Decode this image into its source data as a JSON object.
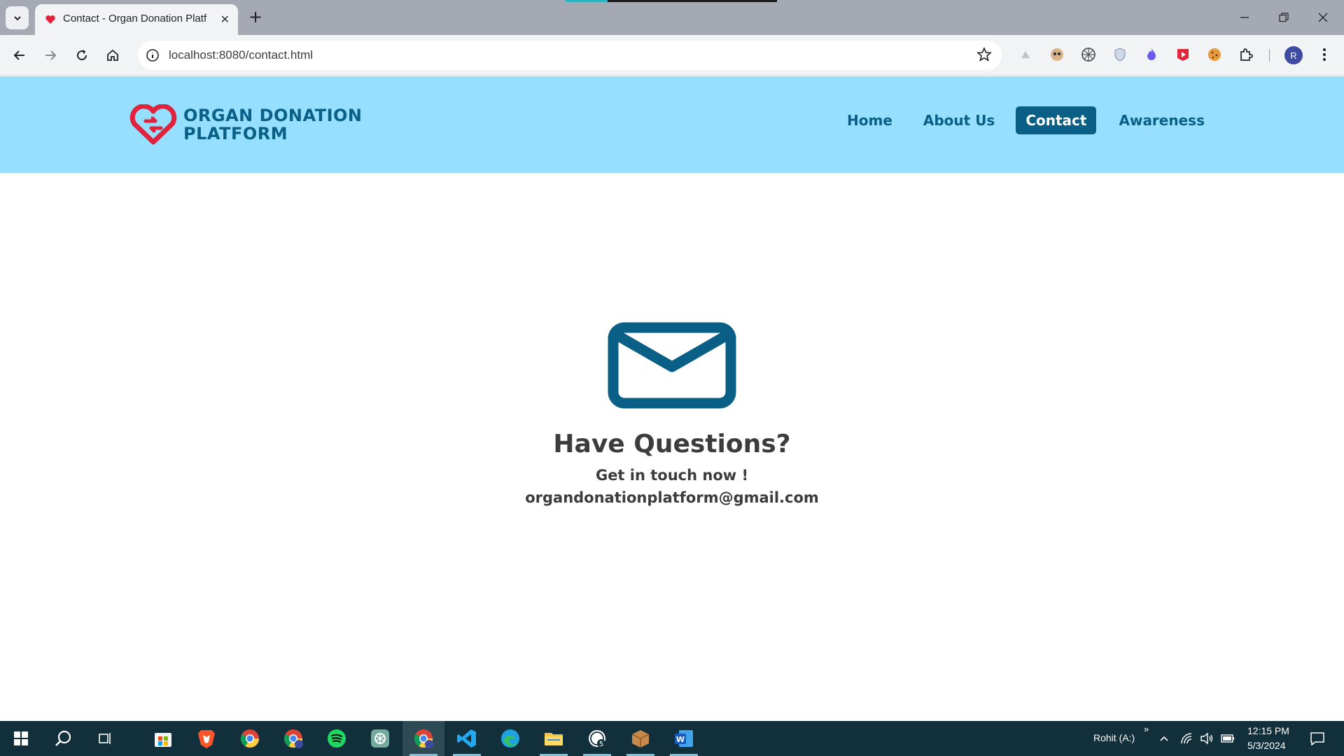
{
  "browser": {
    "tab_title": "Contact - Organ Donation Platf",
    "tab_close": "✕",
    "new_tab": "+",
    "url": "localhost:8080/contact.html",
    "profile_initial": "R"
  },
  "site": {
    "logo_line1": "ORGAN DONATION",
    "logo_line2": "PLATFORM",
    "nav": [
      {
        "label": "Home",
        "active": false
      },
      {
        "label": "About Us",
        "active": false
      },
      {
        "label": "Contact",
        "active": true
      },
      {
        "label": "Awareness",
        "active": false
      }
    ],
    "contact": {
      "title": "Have Questions?",
      "subtitle": "Get in touch now !",
      "email": "organdonationplatform@gmail.com"
    }
  },
  "taskbar": {
    "user": "Rohit (A:)",
    "time": "12:15 PM",
    "date": "5/3/2024",
    "overflow": "»"
  },
  "colors": {
    "header_bg": "#96dffe",
    "brand": "#0a5f86",
    "logo_heart": "#e0223c",
    "text": "#3c3c3c"
  }
}
